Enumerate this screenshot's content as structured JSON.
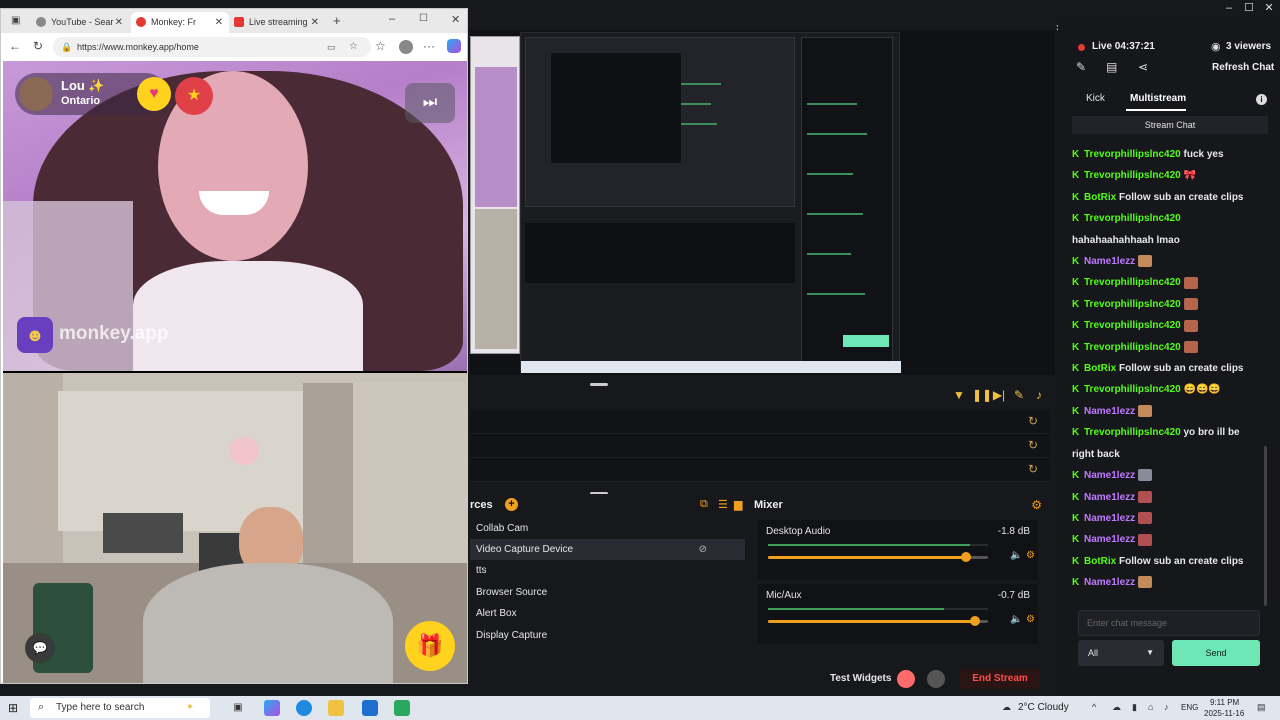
{
  "browser": {
    "tabs": [
      {
        "label": "YouTube - Sear",
        "color": "#999999"
      },
      {
        "label": "Monkey: Fr",
        "color": "#e53935"
      },
      {
        "label": "Live streaming",
        "color": "#e53935"
      }
    ],
    "url": "https://www.monkey.app/home",
    "partner": {
      "name": "Lou ✨",
      "location": "Ontario"
    },
    "brand": "monkey.app"
  },
  "stream": {
    "sources_title": "rces",
    "sources": [
      "Collab Cam",
      "Video Capture Device",
      "tts",
      "Browser Source",
      "Alert Box",
      "Display Capture"
    ],
    "mixer_title": "Mixer",
    "mixer": [
      {
        "name": "Desktop Audio",
        "db": "-1.8 dB",
        "level": 0.9
      },
      {
        "name": "Mic/Aux",
        "db": "-0.7 dB",
        "level": 0.94
      }
    ],
    "test_widgets": "Test Widgets",
    "end_stream": "End Stream"
  },
  "chat": {
    "live": "Live 04:37:21",
    "viewers": "3 viewers",
    "refresh": "Refresh Chat",
    "tabs": [
      "Kick",
      "Multistream"
    ],
    "header": "Stream Chat",
    "messages": [
      {
        "k": true,
        "user": "Trevorphillipslnc420",
        "cls": "u-green",
        "text": "fuck yes"
      },
      {
        "k": true,
        "user": "Trevorphillipslnc420",
        "cls": "u-green",
        "text": "🎀"
      },
      {
        "k": true,
        "user": "BotRix",
        "cls": "u-bot",
        "text": "Follow sub an create clips"
      },
      {
        "k": true,
        "user": "Trevorphillipslnc420",
        "cls": "u-green",
        "text": ""
      },
      {
        "k": false,
        "user": "",
        "cls": "",
        "text": "hahahaahahhaah lmao"
      },
      {
        "k": true,
        "user": "Name1lezz",
        "cls": "u-purple",
        "text": "",
        "emote": "#c58a5a"
      },
      {
        "k": true,
        "user": "Trevorphillipslnc420",
        "cls": "u-green",
        "text": "",
        "emote": "#b5654a"
      },
      {
        "k": true,
        "user": "Trevorphillipslnc420",
        "cls": "u-green",
        "text": "",
        "emote": "#b5654a"
      },
      {
        "k": true,
        "user": "Trevorphillipslnc420",
        "cls": "u-green",
        "text": "",
        "emote": "#b5654a"
      },
      {
        "k": true,
        "user": "Trevorphillipslnc420",
        "cls": "u-green",
        "text": "",
        "emote": "#b5654a"
      },
      {
        "k": true,
        "user": "BotRix",
        "cls": "u-bot",
        "text": "Follow sub an create clips"
      },
      {
        "k": true,
        "user": "Trevorphillipslnc420",
        "cls": "u-green",
        "text": "😄😄😄"
      },
      {
        "k": true,
        "user": "Name1lezz",
        "cls": "u-purple",
        "text": "",
        "emote": "#c58a5a"
      },
      {
        "k": true,
        "user": "Trevorphillipslnc420",
        "cls": "u-green",
        "text": "yo bro ill be"
      },
      {
        "k": false,
        "user": "",
        "cls": "",
        "text": "right back"
      },
      {
        "k": true,
        "user": "Name1lezz",
        "cls": "u-purple",
        "text": "",
        "emote": "#8a8a9a"
      },
      {
        "k": true,
        "user": "Name1lezz",
        "cls": "u-purple",
        "text": "",
        "emote": "#b05050"
      },
      {
        "k": true,
        "user": "Name1lezz",
        "cls": "u-purple",
        "text": "",
        "emote": "#b05050"
      },
      {
        "k": true,
        "user": "Name1lezz",
        "cls": "u-purple",
        "text": "",
        "emote": "#b05050"
      },
      {
        "k": true,
        "user": "BotRix",
        "cls": "u-bot",
        "text": "Follow sub an create clips"
      },
      {
        "k": true,
        "user": "Name1lezz",
        "cls": "u-purple",
        "text": "",
        "emote": "#c58a5a"
      }
    ],
    "input_placeholder": "Enter chat message",
    "select_value": "All",
    "send": "Send"
  },
  "taskbar": {
    "search_placeholder": "Type here to search",
    "weather": "2°C  Cloudy",
    "lang": "ENG",
    "time": "9:11 PM",
    "date": "2025-11-16"
  },
  "colors": {
    "accent": "#f0a020",
    "kick": "#53fc18",
    "send": "#6ee7b7",
    "live": "#e53935"
  }
}
